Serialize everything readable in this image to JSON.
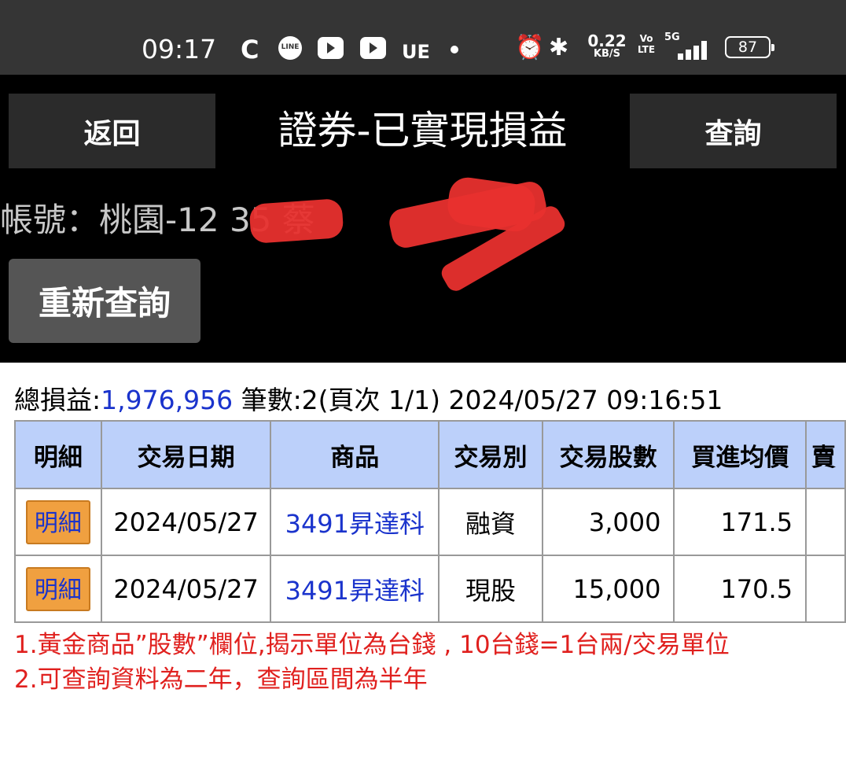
{
  "status_bar": {
    "time": "09:17",
    "carrier_glyph": "C",
    "line_label": "LINE",
    "ue_label": "UE",
    "net_speed": "0.22",
    "net_speed_unit": "KB/S",
    "volte_top": "Vo",
    "volte_bottom": "LTE",
    "network_type": "5G",
    "battery": "87"
  },
  "header": {
    "back_label": "返回",
    "title": "證券-已實現損益",
    "query_label": "查詢"
  },
  "account": {
    "text": "帳號：桃園-12    35 蔡"
  },
  "requery_label": "重新查詢",
  "summary": {
    "total_label": "總損益:",
    "total_value": "1,976,956",
    "rest": " 筆數:2(頁次 1/1) 2024/05/27 09:16:51"
  },
  "table": {
    "headers": [
      "明細",
      "交易日期",
      "商品",
      "交易別",
      "交易股數",
      "買進均價",
      "賣"
    ],
    "rows": [
      {
        "detail": "明細",
        "date": "2024/05/27",
        "product": "3491昇達科",
        "type": "融資",
        "shares": "3,000",
        "avg_price": "171.5"
      },
      {
        "detail": "明細",
        "date": "2024/05/27",
        "product": "3491昇達科",
        "type": "現股",
        "shares": "15,000",
        "avg_price": "170.5"
      }
    ]
  },
  "notes": [
    "1.黃金商品”股數”欄位,揭示單位為台錢 , 10台錢=1台兩/交易單位",
    "2.可查詢資料為二年，查詢區間為半年"
  ],
  "colors": {
    "header_bg": "#bcd0fa",
    "link_blue": "#1a33cc",
    "note_red": "#e0201e",
    "detail_orange": "#f0a040"
  }
}
